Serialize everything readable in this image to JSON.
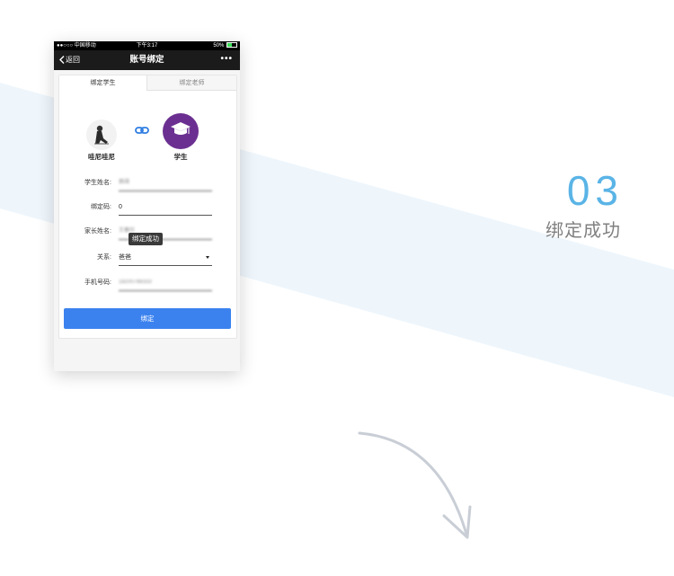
{
  "status_bar": {
    "carrier": "●●○○○ 中国移动",
    "time": "下午3:17",
    "battery": "50%"
  },
  "nav": {
    "back_label": "返回",
    "title": "账号绑定",
    "more_label": "•••"
  },
  "tabs": [
    {
      "label": "绑定学生",
      "active": true
    },
    {
      "label": "绑定老师",
      "active": false
    }
  ],
  "profiles": {
    "left_name": "哇尼哇尼",
    "right_name": "学生"
  },
  "form": {
    "rows": [
      {
        "label": "学生姓名:",
        "value": "佩琦"
      },
      {
        "label": "绑定码:",
        "value": "0"
      },
      {
        "label": "家长姓名:",
        "value": "王春玲"
      },
      {
        "label": "关系:",
        "value": "爸爸"
      },
      {
        "label": "手机号码:",
        "value": "18200788333"
      }
    ],
    "toast": "绑定成功",
    "submit_label": "绑定"
  },
  "step": {
    "number": "03",
    "title": "绑定成功"
  },
  "colors": {
    "accent": "#5ab4e6",
    "button": "#3b82ef",
    "avatar_purple": "#6b2f91",
    "band": "#eef6fc"
  },
  "icons": {
    "link": "link-icon",
    "graduation": "graduation-cap-icon",
    "back": "chevron-left-icon",
    "arrow": "curved-arrow-down-icon"
  }
}
